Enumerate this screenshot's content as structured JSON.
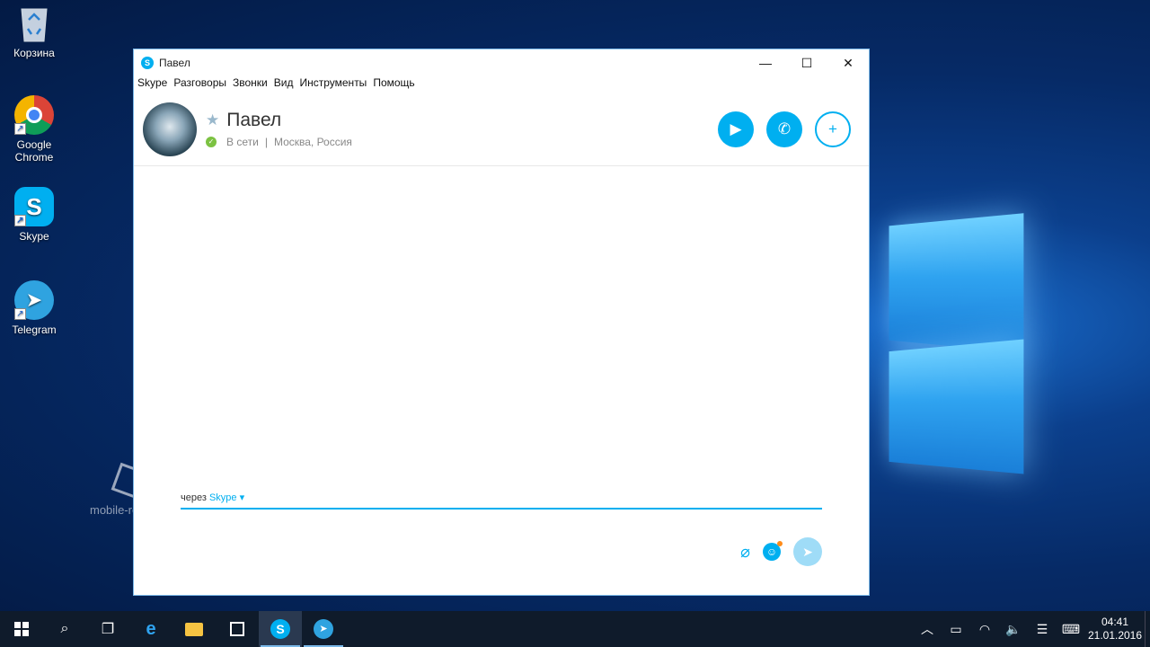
{
  "desktop": {
    "icons": [
      {
        "label": "Корзина",
        "icon": "recycle-bin-icon"
      },
      {
        "label": "Google\nChrome",
        "icon": "chrome-icon"
      },
      {
        "label": "Skype",
        "icon": "skype-icon"
      },
      {
        "label": "Telegram",
        "icon": "telegram-icon"
      }
    ],
    "watermark": "mobile-review.com"
  },
  "window": {
    "title": "Павел",
    "controls": {
      "minimize": "—",
      "maximize": "☐",
      "close": "✕"
    },
    "menu": [
      "Skype",
      "Разговоры",
      "Звонки",
      "Вид",
      "Инструменты",
      "Помощь"
    ]
  },
  "contact": {
    "name": "Павел",
    "status": "В сети",
    "separator": "|",
    "location": "Москва, Россия",
    "favorite_glyph": "★",
    "status_glyph": "✓"
  },
  "actions": {
    "video_glyph": "▶",
    "call_glyph": "✆",
    "add_glyph": "+"
  },
  "compose": {
    "via_label": "через",
    "via_service": "Skype",
    "dropdown_glyph": "▾",
    "attach_glyph": "⌀",
    "emoji_glyph": "☺",
    "send_glyph": "➤"
  },
  "taskbar": {
    "search_glyph": "⌕",
    "taskview_glyph": "❐",
    "edge_glyph": "e",
    "skype_glyph": "S",
    "telegram_glyph": "➤",
    "tray": {
      "chevron": "︿",
      "battery": "▭",
      "wifi": "◠",
      "volume": "🔈",
      "notifications": "☰",
      "keyboard": "⌨"
    },
    "time": "04:41",
    "date": "21.01.2016"
  },
  "colors": {
    "accent": "#00aff0",
    "online": "#7cc242",
    "taskbar": "#0f1b2b"
  }
}
